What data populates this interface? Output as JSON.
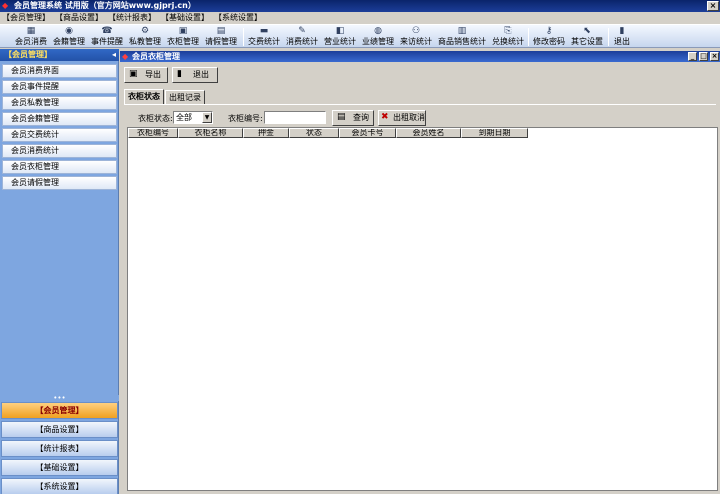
{
  "window": {
    "title": "会员管理系统 试用版（官方网站www.gjprj.cn）",
    "close_glyph": "×"
  },
  "menu": [
    "【会员管理】",
    "【商品设置】",
    "【统计报表】",
    "【基础设置】",
    "【系统设置】"
  ],
  "toolbar": [
    {
      "label": "会员消费",
      "icon": "▦"
    },
    {
      "label": "会籍管理",
      "icon": "◉"
    },
    {
      "label": "事件提醒",
      "icon": "☎"
    },
    {
      "label": "私教管理",
      "icon": "⚙"
    },
    {
      "label": "衣柜管理",
      "icon": "▣"
    },
    {
      "label": "请假管理",
      "icon": "▤"
    },
    {
      "label": "交费统计",
      "icon": "▬"
    },
    {
      "label": "消费统计",
      "icon": "✎"
    },
    {
      "label": "营业统计",
      "icon": "◧"
    },
    {
      "label": "业绩管理",
      "icon": "◍"
    },
    {
      "label": "来访统计",
      "icon": "⚇"
    },
    {
      "label": "商品销售统计",
      "icon": "▥"
    },
    {
      "label": "兑换统计",
      "icon": "⎘"
    },
    {
      "label": "修改密码",
      "icon": "⚷"
    },
    {
      "label": "其它设置",
      "icon": "⬉"
    },
    {
      "label": "退出",
      "icon": "▮"
    }
  ],
  "sidebar": {
    "header": "【会员管理】",
    "collapse_glyph": "◂",
    "grip_glyph": "•••",
    "items": [
      "会员消费界面",
      "会员事件提醒",
      "会员私教管理",
      "会员会籍管理",
      "会员交费统计",
      "会员消费统计",
      "会员衣柜管理",
      "会员请假管理"
    ],
    "groups": [
      {
        "label": "【会员管理】",
        "active": true
      },
      {
        "label": "【商品设置】",
        "active": false
      },
      {
        "label": "【统计报表】",
        "active": false
      },
      {
        "label": "【基础设置】",
        "active": false
      },
      {
        "label": "【系统设置】",
        "active": false
      }
    ]
  },
  "panel": {
    "title": "会员衣柜管理",
    "title_icon": "◆",
    "minimize_glyph": "_",
    "restore_glyph": "□",
    "close_glyph": "×",
    "export_label": "导出",
    "export_icon": "▣",
    "exit_label": "退出",
    "exit_icon": "▮",
    "tabs": [
      {
        "label": "衣柜状态",
        "active": true
      },
      {
        "label": "出租记录",
        "active": false
      }
    ],
    "filters": {
      "status_label": "衣柜状态:",
      "status_value": "全部",
      "dropdown_glyph": "▼",
      "number_label": "衣柜编号:",
      "number_value": "",
      "query_label": "查询",
      "query_icon": "▤",
      "cancel_label": "出租取消",
      "cancel_icon": "✖"
    },
    "columns": [
      "衣柜编号",
      "衣柜名称",
      "押金",
      "状态",
      "会员卡号",
      "会员姓名",
      "到期日期"
    ]
  }
}
